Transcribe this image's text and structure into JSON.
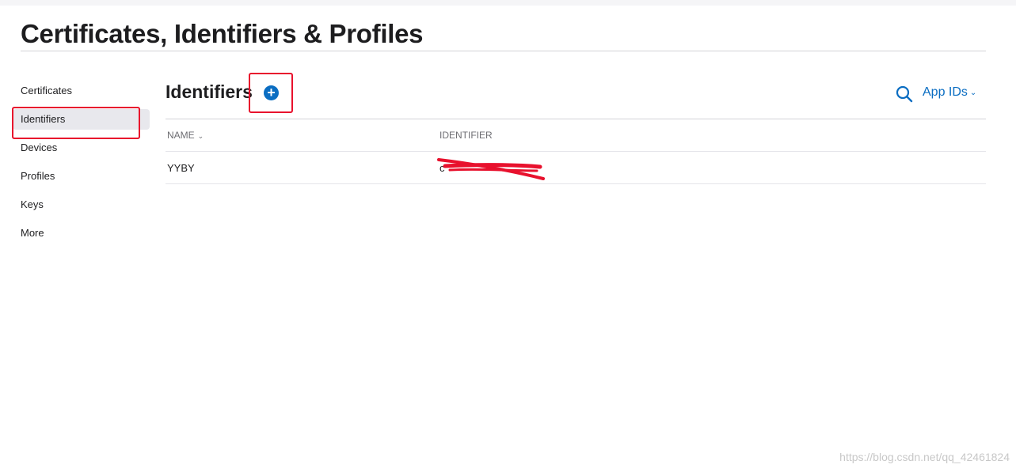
{
  "page": {
    "title": "Certificates, Identifiers & Profiles"
  },
  "sidebar": {
    "items": [
      {
        "label": "Certificates"
      },
      {
        "label": "Identifiers"
      },
      {
        "label": "Devices"
      },
      {
        "label": "Profiles"
      },
      {
        "label": "Keys"
      },
      {
        "label": "More"
      }
    ],
    "active": "Identifiers"
  },
  "section": {
    "title": "Identifiers",
    "add_icon": "plus-circle-icon",
    "search_icon": "search-icon",
    "filter_label": "App IDs",
    "filter_chevron": "chevron-down-icon"
  },
  "table": {
    "columns": [
      {
        "label": "NAME",
        "sortable": true
      },
      {
        "label": "IDENTIFIER",
        "sortable": false
      }
    ],
    "rows": [
      {
        "name": "YYBY",
        "identifier": "c"
      }
    ]
  },
  "annotations": {
    "color": "#e8112d"
  },
  "accent_color": "#0a6dc2",
  "watermark": "https://blog.csdn.net/qq_42461824"
}
